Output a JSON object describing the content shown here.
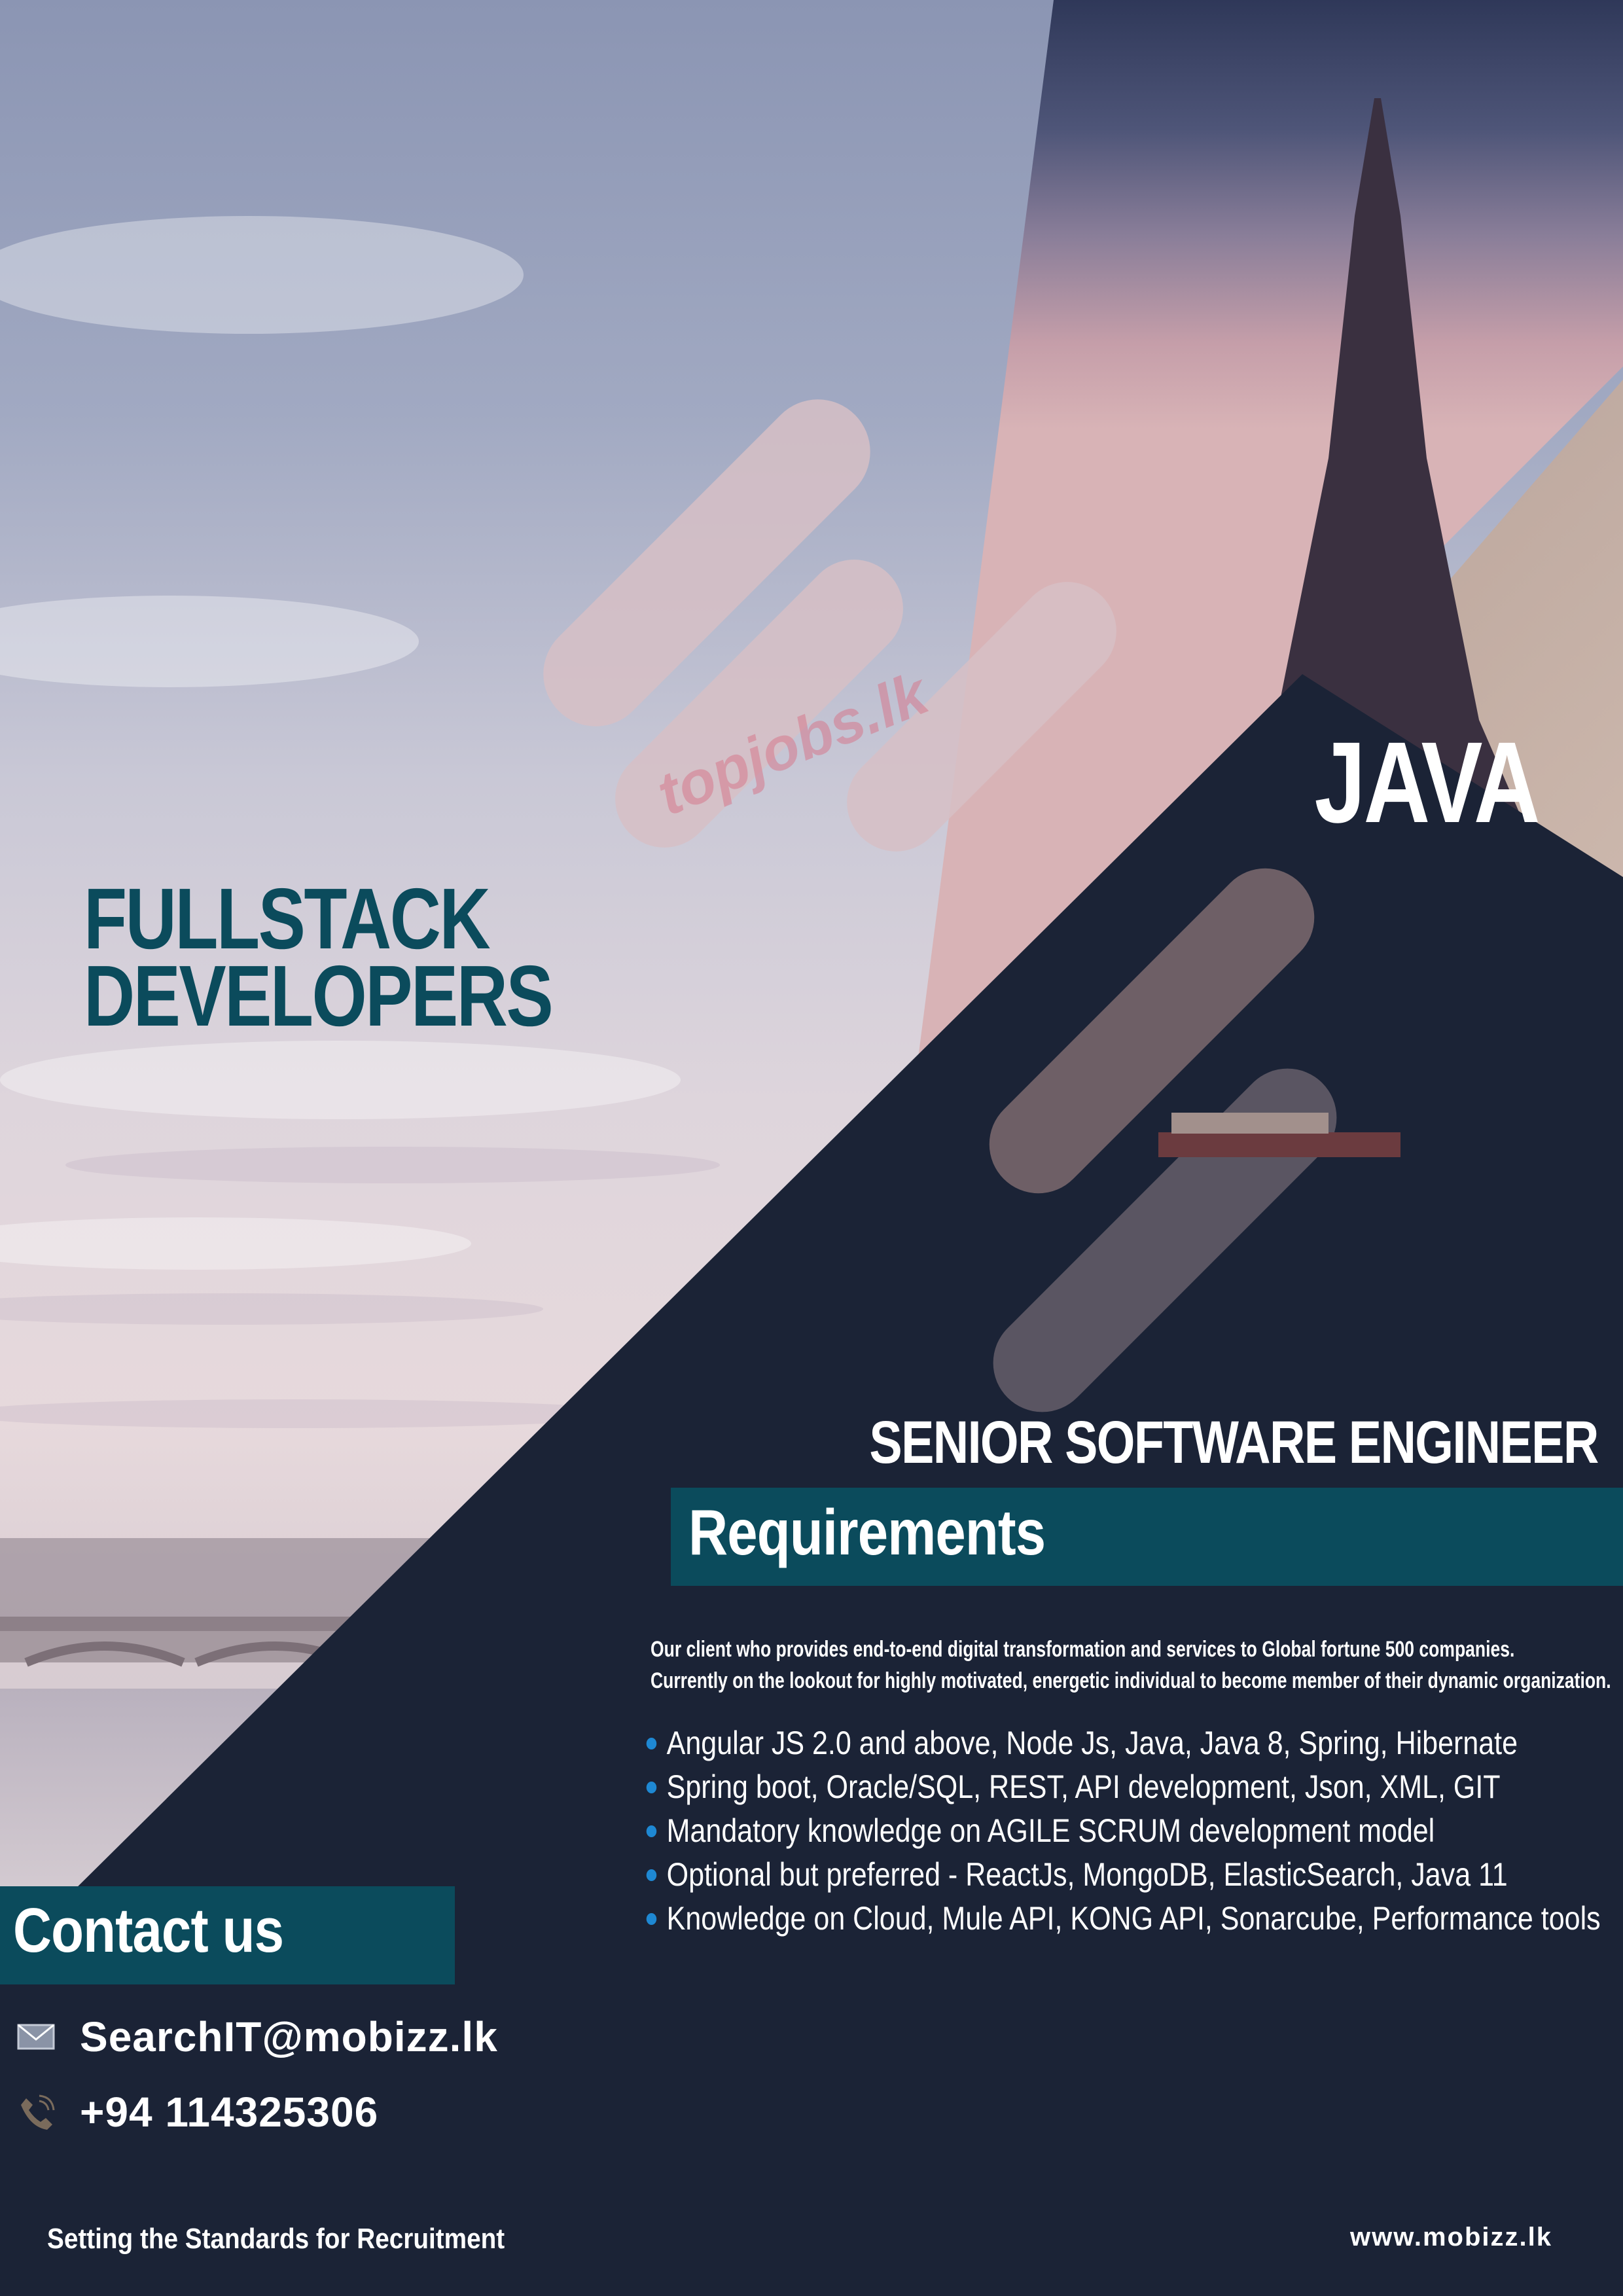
{
  "watermark": "topjobs.lk",
  "headline": {
    "line1": "FULLSTACK",
    "line2": "DEVELOPERS"
  },
  "tech_label": "JAVA",
  "job_title": "SENIOR SOFTWARE ENGINEER",
  "requirements": {
    "heading": "Requirements",
    "intro_line1": "Our client who provides end-to-end digital transformation and services to Global fortune 500 companies.",
    "intro_line2": "Currently on the lookout for highly motivated, energetic individual to become member of their dynamic organization.",
    "items": [
      "Angular JS 2.0 and above, Node Js, Java, Java 8, Spring, Hibernate",
      "Spring boot, Oracle/SQL, REST, API development, Json, XML, GIT",
      "Mandatory knowledge on AGILE SCRUM development model",
      "Optional but preferred - ReactJs, MongoDB, ElasticSearch, Java 11",
      "Knowledge on Cloud, Mule API, KONG API, Sonarcube, Performance tools"
    ]
  },
  "contact": {
    "heading": "Contact us",
    "email": "SearchIT@mobizz.lk",
    "phone": "+94 114325306",
    "email_icon": "envelope-icon",
    "phone_icon": "phone-icon"
  },
  "footer": {
    "tagline": "Setting the Standards for Recruitment",
    "website": "www.mobizz.lk"
  },
  "colors": {
    "navy": "#1b2336",
    "teal": "#0b4b5c",
    "bullet": "#1e88d3",
    "white": "#ffffff"
  }
}
